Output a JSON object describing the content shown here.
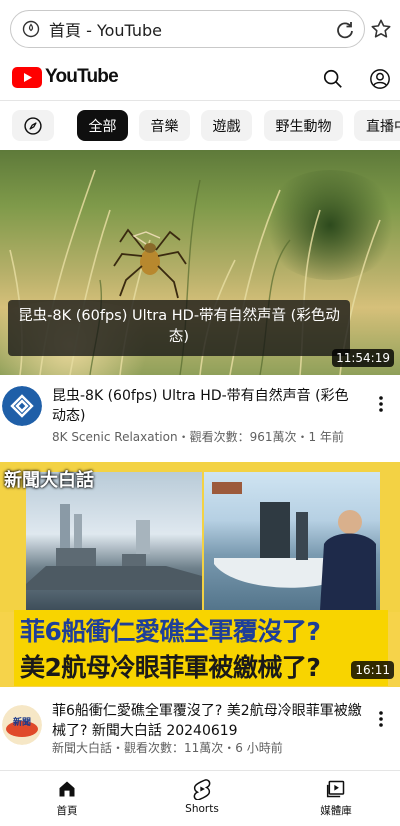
{
  "browser": {
    "url_text": "首頁 - YouTube"
  },
  "header": {
    "logo_text": "YouTube"
  },
  "chips": [
    "全部",
    "音樂",
    "遊戲",
    "野生動物",
    "直播中"
  ],
  "videos": [
    {
      "thumb_caption": "昆虫-8K (60fps) Ultra HD-带有自然声音 (彩色动态)",
      "duration": "11:54:19",
      "title": "昆虫-8K (60fps) Ultra HD-带有自然声音 (彩色动态)",
      "meta": "8K Scenic Relaxation・觀看次數：961萬次・1 年前"
    },
    {
      "thumb_logo": "新聞大白話",
      "banner_line1": "菲6船衝仁愛礁全軍覆沒了?",
      "banner_line2": "美2航母冷眼菲軍被繳械了?",
      "duration": "16:11",
      "title": "菲6船衝仁愛礁全軍覆沒了? 美2航母冷眼菲軍被繳械了? 新聞大白話 20240619",
      "meta": "新聞大白話・觀看次數：11萬次・6 小時前"
    }
  ],
  "bottom_nav": {
    "home": "首頁",
    "shorts": "Shorts",
    "library": "媒體庫"
  },
  "colors": {
    "brand_red": "#ff0000",
    "chip_active": "#0f0f0f",
    "chip_bg": "#f2f2f2"
  }
}
